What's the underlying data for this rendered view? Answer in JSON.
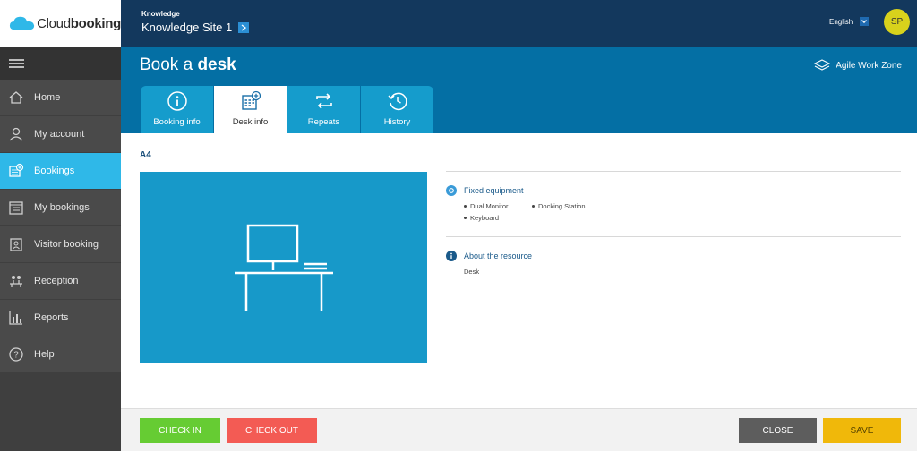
{
  "brand": {
    "name_light": "Cloud",
    "name_bold": "booking"
  },
  "sidebar": {
    "items": [
      {
        "label": "Home",
        "icon": "home-icon"
      },
      {
        "label": "My account",
        "icon": "user-icon"
      },
      {
        "label": "Bookings",
        "icon": "calendar-plus-icon",
        "active": true
      },
      {
        "label": "My bookings",
        "icon": "calendar-list-icon"
      },
      {
        "label": "Visitor booking",
        "icon": "visitor-icon"
      },
      {
        "label": "Reception",
        "icon": "reception-icon"
      },
      {
        "label": "Reports",
        "icon": "bar-chart-icon"
      },
      {
        "label": "Help",
        "icon": "help-icon"
      }
    ]
  },
  "header": {
    "breadcrumb_top": "Knowledge",
    "site": "Knowledge Site 1",
    "language": "English",
    "avatar_initials": "SP"
  },
  "band": {
    "title_prefix": "Book a ",
    "title_bold": "desk",
    "zone": "Agile Work Zone"
  },
  "tabs": [
    {
      "label": "Booking info",
      "icon": "info-icon"
    },
    {
      "label": "Desk info",
      "icon": "desk-calendar-icon",
      "active": true
    },
    {
      "label": "Repeats",
      "icon": "repeat-icon"
    },
    {
      "label": "History",
      "icon": "history-icon"
    }
  ],
  "desk": {
    "name": "A4",
    "fixed_equipment_title": "Fixed equipment",
    "equipment": [
      "Dual Monitor",
      "Docking Station",
      "Keyboard"
    ],
    "about_title": "About the resource",
    "about_value": "Desk"
  },
  "footer": {
    "check_in": "CHECK IN",
    "check_out": "CHECK OUT",
    "close": "CLOSE",
    "save": "SAVE"
  },
  "colors": {
    "sidebar": "#3f3f3f",
    "active": "#2fb8e8",
    "topbar": "#13385d",
    "band": "#046fa4",
    "check_in": "#66cc33",
    "check_out": "#f35b54",
    "close": "#5d5d5d",
    "save": "#f0b80a"
  }
}
